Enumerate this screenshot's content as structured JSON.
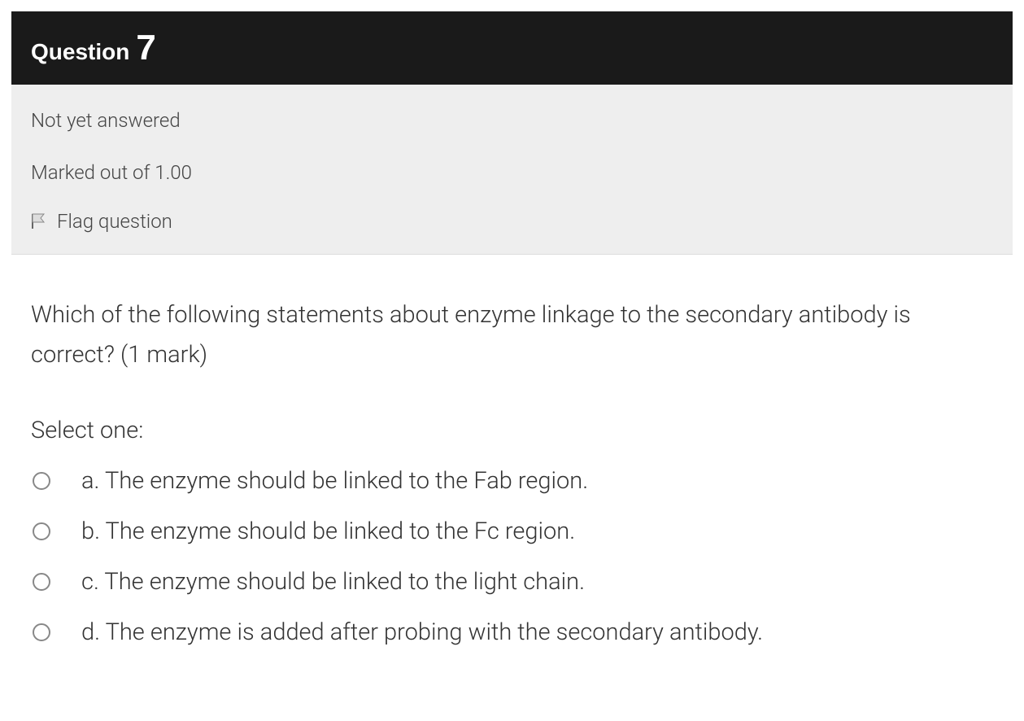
{
  "header": {
    "label": "Question",
    "number": "7"
  },
  "meta": {
    "status": "Not yet answered",
    "marks": "Marked out of 1.00",
    "flag": "Flag question"
  },
  "question": {
    "text": "Which of the following statements about enzyme linkage to the secondary antibody is correct? (1 mark)",
    "select_one": "Select one:",
    "options": [
      {
        "letter": "a.",
        "text": "The enzyme should be linked to the Fab region."
      },
      {
        "letter": "b.",
        "text": "The enzyme should be linked to the Fc region."
      },
      {
        "letter": "c.",
        "text": "The enzyme should be linked to the light chain."
      },
      {
        "letter": "d.",
        "text": "The enzyme is added after probing with the secondary antibody."
      }
    ]
  }
}
